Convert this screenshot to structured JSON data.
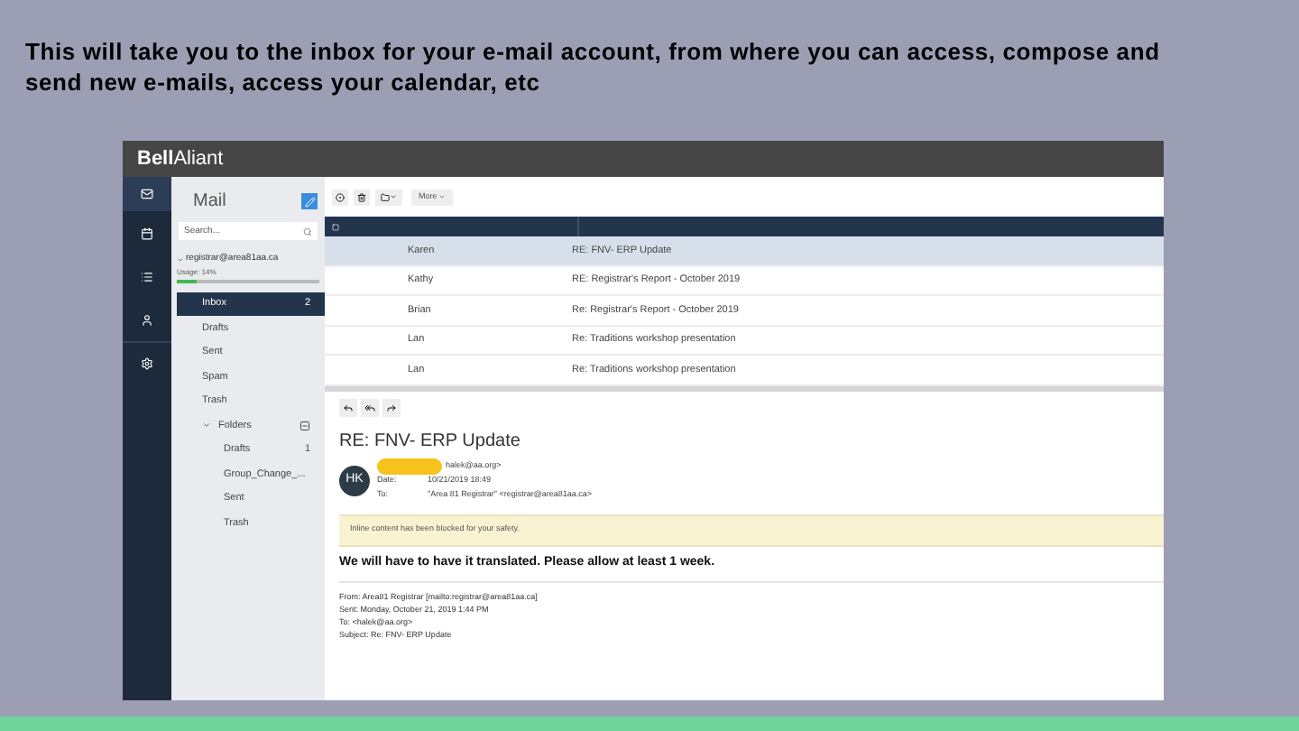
{
  "caption": "This will take you to the inbox for your e-mail account, from where you can access, compose and send new e-mails, access your calendar, etc",
  "app": {
    "logo": {
      "bold": "Bell",
      "light": "Aliant"
    },
    "sidebar": {
      "title": "Mail",
      "search": {
        "placeholder": "Search..."
      },
      "account": "registrar@area81aa.ca",
      "usage": {
        "label": "Usage: 14%",
        "level": 0.14
      },
      "folders": [
        {
          "name": "Inbox",
          "count": "2",
          "selected": true
        },
        {
          "name": "Drafts",
          "selected": false
        },
        {
          "name": "Sent",
          "selected": false
        },
        {
          "name": "Spam",
          "selected": false
        },
        {
          "name": "Trash",
          "selected": false
        },
        {
          "name": "Folders",
          "selected": false,
          "expanded": true,
          "children": [
            {
              "name": "Drafts",
              "count": "1",
              "selected": false
            },
            {
              "name": "Group_Change_...",
              "selected": false
            },
            {
              "name": "Sent",
              "selected": false
            },
            {
              "name": "Trash",
              "selected": false
            }
          ]
        }
      ]
    },
    "toolbar": {
      "more": "More"
    },
    "list_header": {
      "checked": false
    },
    "messages": [
      {
        "sender": "Karen",
        "subject": "RE: FNV- ERP Update",
        "selected": true
      },
      {
        "sender": "Kathy",
        "subject": "RE: Registrar's Report - October 2019",
        "selected": false
      },
      {
        "sender": "Brian",
        "subject": "Re: Registrar's Report - October 2019",
        "selected": false
      },
      {
        "sender": "Lan",
        "subject": "Re: Traditions workshop presentation",
        "selected": false
      },
      {
        "sender": "Lan",
        "subject": "Re: Traditions workshop presentation",
        "selected": false
      }
    ],
    "reader": {
      "subject": "RE: FNV- ERP Update",
      "avatar": "HK",
      "fields": [
        {
          "value": "halek@aa.org>"
        },
        {
          "label": "Date:",
          "value": "10/21/2019 18:49"
        },
        {
          "label": "To:",
          "value": "\"Area 81 Registrar\" <registrar@area81aa.ca>"
        }
      ],
      "notice": "Inline content has been blocked for your safety.",
      "body": "We will have to have it translated. Please allow at least 1 week.",
      "quoted": [
        "From: Area81 Registrar [mailto:registrar@area81aa.ca]",
        "Sent: Monday, October 21, 2019 1:44 PM",
        "To: <halek@aa.org>",
        "Subject: Re: FNV- ERP Update"
      ]
    }
  }
}
